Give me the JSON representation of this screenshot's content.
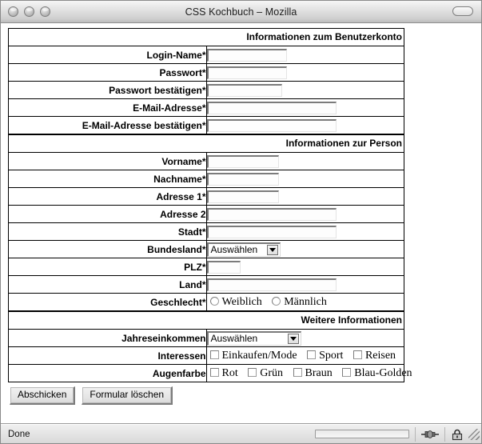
{
  "window": {
    "title": "CSS Kochbuch – Mozilla",
    "traffic_lights": [
      "close",
      "minimize",
      "zoom"
    ],
    "toolbar_toggle": "toolbar-pill"
  },
  "form": {
    "sections": [
      {
        "legend": "Informationen zum Benutzerkonto",
        "rows": [
          {
            "label": "Login-Name*",
            "control": "text",
            "size": "small"
          },
          {
            "label": "Passwort*",
            "control": "text",
            "size": "small"
          },
          {
            "label": "Passwort bestätigen*",
            "control": "text",
            "size": "med"
          },
          {
            "label": "E-Mail-Adresse*",
            "control": "text",
            "size": "large"
          },
          {
            "label": "E-Mail-Adresse bestätigen*",
            "control": "text",
            "size": "large"
          }
        ]
      },
      {
        "legend": "Informationen zur Person",
        "rows": [
          {
            "label": "Vorname*",
            "control": "text",
            "size": "mid"
          },
          {
            "label": "Nachname*",
            "control": "text",
            "size": "mid"
          },
          {
            "label": "Adresse 1*",
            "control": "text",
            "size": "mid"
          },
          {
            "label": "Adresse 2",
            "control": "text",
            "size": "large"
          },
          {
            "label": "Stadt*",
            "control": "text",
            "size": "large"
          },
          {
            "label": "Bundesland*",
            "control": "select",
            "value": "Auswählen"
          },
          {
            "label": "PLZ*",
            "control": "text",
            "size": "tiny"
          },
          {
            "label": "Land*",
            "control": "text",
            "size": "large"
          },
          {
            "label": "Geschlecht*",
            "control": "radios",
            "options": [
              "Weiblich",
              "Männlich"
            ]
          }
        ]
      },
      {
        "legend": "Weitere Informationen",
        "rows": [
          {
            "label": "Jahreseinkommen",
            "control": "select",
            "value": "Auswählen"
          },
          {
            "label": "Interessen",
            "control": "checkboxes",
            "options": [
              "Einkaufen/Mode",
              "Sport",
              "Reisen"
            ]
          },
          {
            "label": "Augenfarbe",
            "control": "checkboxes",
            "options": [
              "Rot",
              "Grün",
              "Braun",
              "Blau-Golden"
            ]
          }
        ]
      }
    ],
    "buttons": {
      "submit": "Abschicken",
      "reset": "Formular löschen"
    }
  },
  "statusbar": {
    "text": "Done",
    "progress_percent": 0,
    "icons": [
      "network-plug-icon",
      "padlock-icon",
      "resize-grip-icon"
    ]
  }
}
